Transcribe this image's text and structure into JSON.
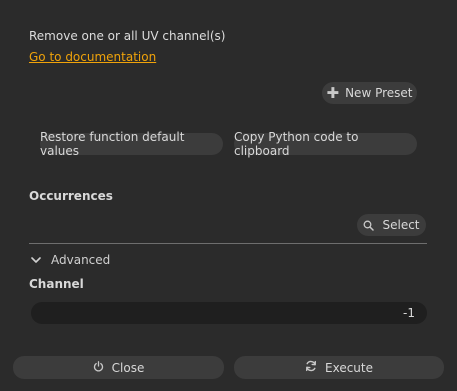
{
  "description": "Remove one or all UV channel(s)",
  "documentation_link": "Go to documentation",
  "presets": {
    "new_preset_label": "New Preset",
    "new_preset_icon": "plus-icon"
  },
  "actions": {
    "restore_label": "Restore function default values",
    "copy_label": "Copy Python code to clipboard"
  },
  "occurrences": {
    "label": "Occurrences",
    "select_label": "Select",
    "select_icon": "search-icon"
  },
  "advanced": {
    "label": "Advanced",
    "expanded": true,
    "icon": "chevron-down-icon"
  },
  "channel": {
    "label": "Channel",
    "value": "-1"
  },
  "footer": {
    "close_label": "Close",
    "close_icon": "power-icon",
    "execute_label": "Execute",
    "execute_icon": "refresh-icon"
  },
  "colors": {
    "background": "#2b2b2b",
    "button": "#3c3c3c",
    "input": "#1f1f1f",
    "link": "#f0a30a"
  }
}
